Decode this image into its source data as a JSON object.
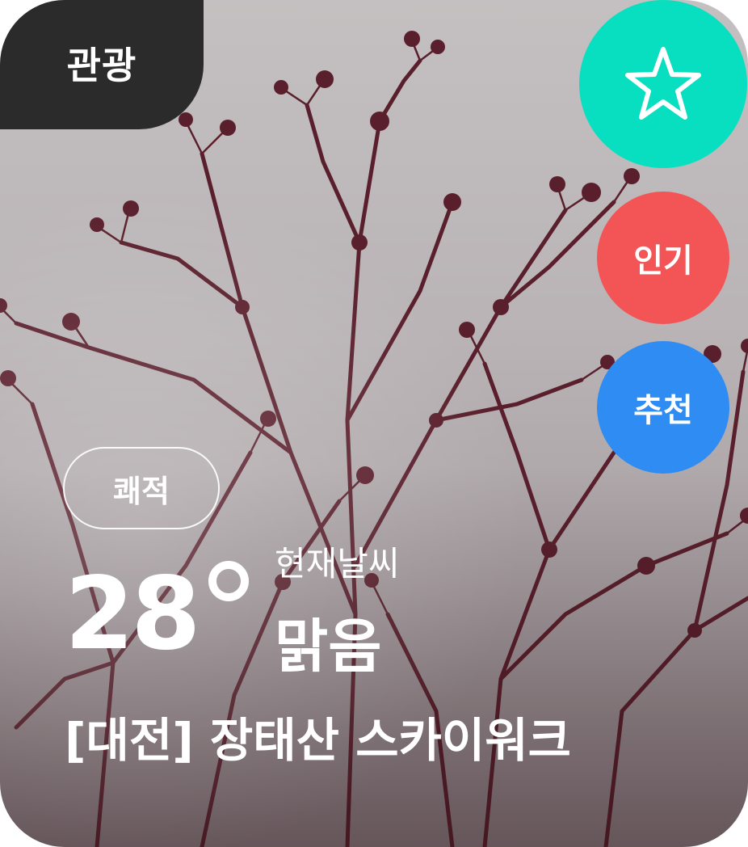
{
  "card": {
    "category": "관광",
    "favorite_icon": "star-outline-icon",
    "badges": {
      "popular": "인기",
      "recommend": "추천"
    },
    "comfort": "쾌적",
    "temperature": "28",
    "weather_label": "현재날씨",
    "weather_value": "맑음",
    "place_name": "[대전] 장태산 스카이워크"
  },
  "colors": {
    "category_bg": "#2b2b2b",
    "favorite_bg": "#08dfc0",
    "popular_bg": "#f35456",
    "recommend_bg": "#2f8cf2",
    "text": "#ffffff"
  }
}
